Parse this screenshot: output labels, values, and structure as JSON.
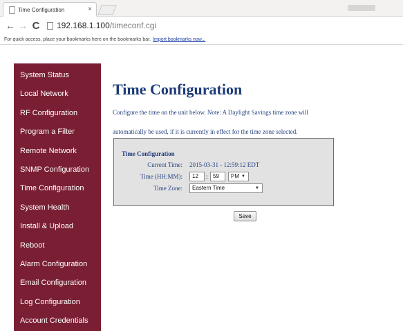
{
  "browser": {
    "tab_title": "Time Configuration",
    "tab_close": "×",
    "back_icon": "←",
    "forward_icon": "→",
    "reload_icon": "C",
    "url_host": "192.168.1.100",
    "url_path": "/timeconf.cgi",
    "bookmarks_prompt": "For quick access, place your bookmarks here on the bookmarks bar.",
    "bookmarks_import_link": "Import bookmarks now..."
  },
  "sidebar": {
    "items": [
      {
        "label": "System Status"
      },
      {
        "label": "Local Network"
      },
      {
        "label": "RF Configuration"
      },
      {
        "label": "Program a Filter"
      },
      {
        "label": "Remote Network"
      },
      {
        "label": "SNMP Configuration"
      },
      {
        "label": "Time Configuration"
      },
      {
        "label": "System Health"
      },
      {
        "label": "Install & Upload"
      },
      {
        "label": "Reboot"
      },
      {
        "label": "Alarm Configuration"
      },
      {
        "label": "Email Configuration"
      },
      {
        "label": "Log Configuration"
      },
      {
        "label": "Account Credentials"
      }
    ]
  },
  "main": {
    "title": "Time Configuration",
    "intro_line1": "Configure the time on the unit below. Note: A Daylight Savings time zone will",
    "intro_line2": "automatically be used, if it is currently in effect for the time zone selected.",
    "panel": {
      "heading": "Time Configuration",
      "current_time_label": "Current Time:",
      "current_time_value": "2015-03-31 - 12:59:12 EDT",
      "time_label": "Time (HH:MM):",
      "hour_value": "12",
      "time_separator": ":",
      "minute_value": "59",
      "ampm_value": "PM",
      "timezone_label": "Time Zone:",
      "timezone_value": "Eastern Time"
    },
    "save_label": "Save"
  },
  "colors": {
    "sidebar_bg": "#7a1f33",
    "title_blue": "#1c3a78",
    "panel_bg": "#e2e2e2"
  }
}
